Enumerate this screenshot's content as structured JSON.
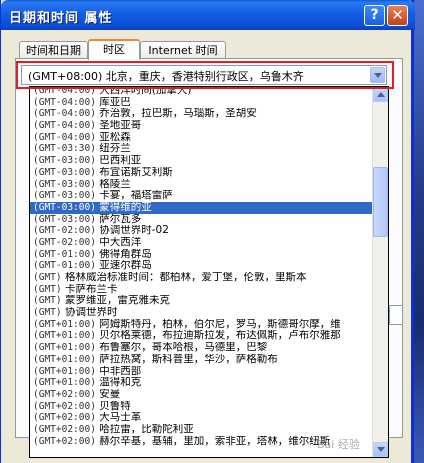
{
  "window": {
    "title": "日期和时间  属性"
  },
  "titlebar": {
    "help": "?",
    "close": "✕"
  },
  "tabs": [
    {
      "label": "时间和日期"
    },
    {
      "label": "时区"
    },
    {
      "label": "Internet 时间"
    }
  ],
  "timezone_select": {
    "value": "(GMT+08:00) 北京，重庆，香港特别行政区，乌鲁木齐"
  },
  "dropdown_items": [
    {
      "gmt": "(GMT-04:00)",
      "name": "大西洋时间(加拿大)"
    },
    {
      "gmt": "(GMT-04:00)",
      "name": "库亚巴"
    },
    {
      "gmt": "(GMT-04:00)",
      "name": "乔治敦，拉巴斯，马瑙斯，圣胡安"
    },
    {
      "gmt": "(GMT-04:00)",
      "name": "圣地亚哥"
    },
    {
      "gmt": "(GMT-04:00)",
      "name": "亚松森"
    },
    {
      "gmt": "(GMT-03:30)",
      "name": "纽芬兰"
    },
    {
      "gmt": "(GMT-03:00)",
      "name": "巴西利亚"
    },
    {
      "gmt": "(GMT-03:00)",
      "name": "布宜诺斯艾利斯"
    },
    {
      "gmt": "(GMT-03:00)",
      "name": "格陵兰"
    },
    {
      "gmt": "(GMT-03:00)",
      "name": "卡宴，福塔雷萨"
    },
    {
      "gmt": "(GMT-03:00)",
      "name": "蒙得维的亚",
      "selected": true
    },
    {
      "gmt": "(GMT-03:00)",
      "name": "萨尔瓦多"
    },
    {
      "gmt": "(GMT-02:00)",
      "name": "协调世界时-02"
    },
    {
      "gmt": "(GMT-02:00)",
      "name": "中大西洋"
    },
    {
      "gmt": "(GMT-01:00)",
      "name": "佛得角群岛"
    },
    {
      "gmt": "(GMT-01:00)",
      "name": "亚速尔群岛"
    },
    {
      "gmt": "(GMT)",
      "name": "格林威治标准时间：都柏林，爱丁堡，伦敦，里斯本"
    },
    {
      "gmt": "(GMT)",
      "name": "卡萨布兰卡"
    },
    {
      "gmt": "(GMT)",
      "name": "蒙罗维亚，雷克雅未克"
    },
    {
      "gmt": "(GMT)",
      "name": "协调世界时"
    },
    {
      "gmt": "(GMT+01:00)",
      "name": "阿姆斯特丹，柏林，伯尔尼，罗马，斯德哥尔摩，维"
    },
    {
      "gmt": "(GMT+01:00)",
      "name": "贝尔格莱德，布拉迪斯拉发，布达佩斯，卢布尔雅那"
    },
    {
      "gmt": "(GMT+01:00)",
      "name": "布鲁塞尔，哥本哈根，马德里，巴黎"
    },
    {
      "gmt": "(GMT+01:00)",
      "name": "萨拉热窝，斯科普里，华沙，萨格勒布"
    },
    {
      "gmt": "(GMT+01:00)",
      "name": "中非西部"
    },
    {
      "gmt": "(GMT+01:00)",
      "name": "温得和克"
    },
    {
      "gmt": "(GMT+02:00)",
      "name": "安曼"
    },
    {
      "gmt": "(GMT+02:00)",
      "name": "贝鲁特"
    },
    {
      "gmt": "(GMT+02:00)",
      "name": "大马士革"
    },
    {
      "gmt": "(GMT+02:00)",
      "name": "哈拉雷，比勒陀利亚"
    },
    {
      "gmt": "(GMT+02:00)",
      "name": "赫尔辛基，基辅，里加，索非亚，塔林，维尔纽斯"
    }
  ],
  "watermark": "Bai 经验",
  "colors": {
    "selection": "#316ac5",
    "titlebar": "#0a4fd6",
    "highlight_box": "#e02020",
    "active_tab_accent": "#e68b2c"
  },
  "icons": {
    "help": "help-icon",
    "close": "close-icon",
    "dropdown": "chevron-down-icon"
  }
}
